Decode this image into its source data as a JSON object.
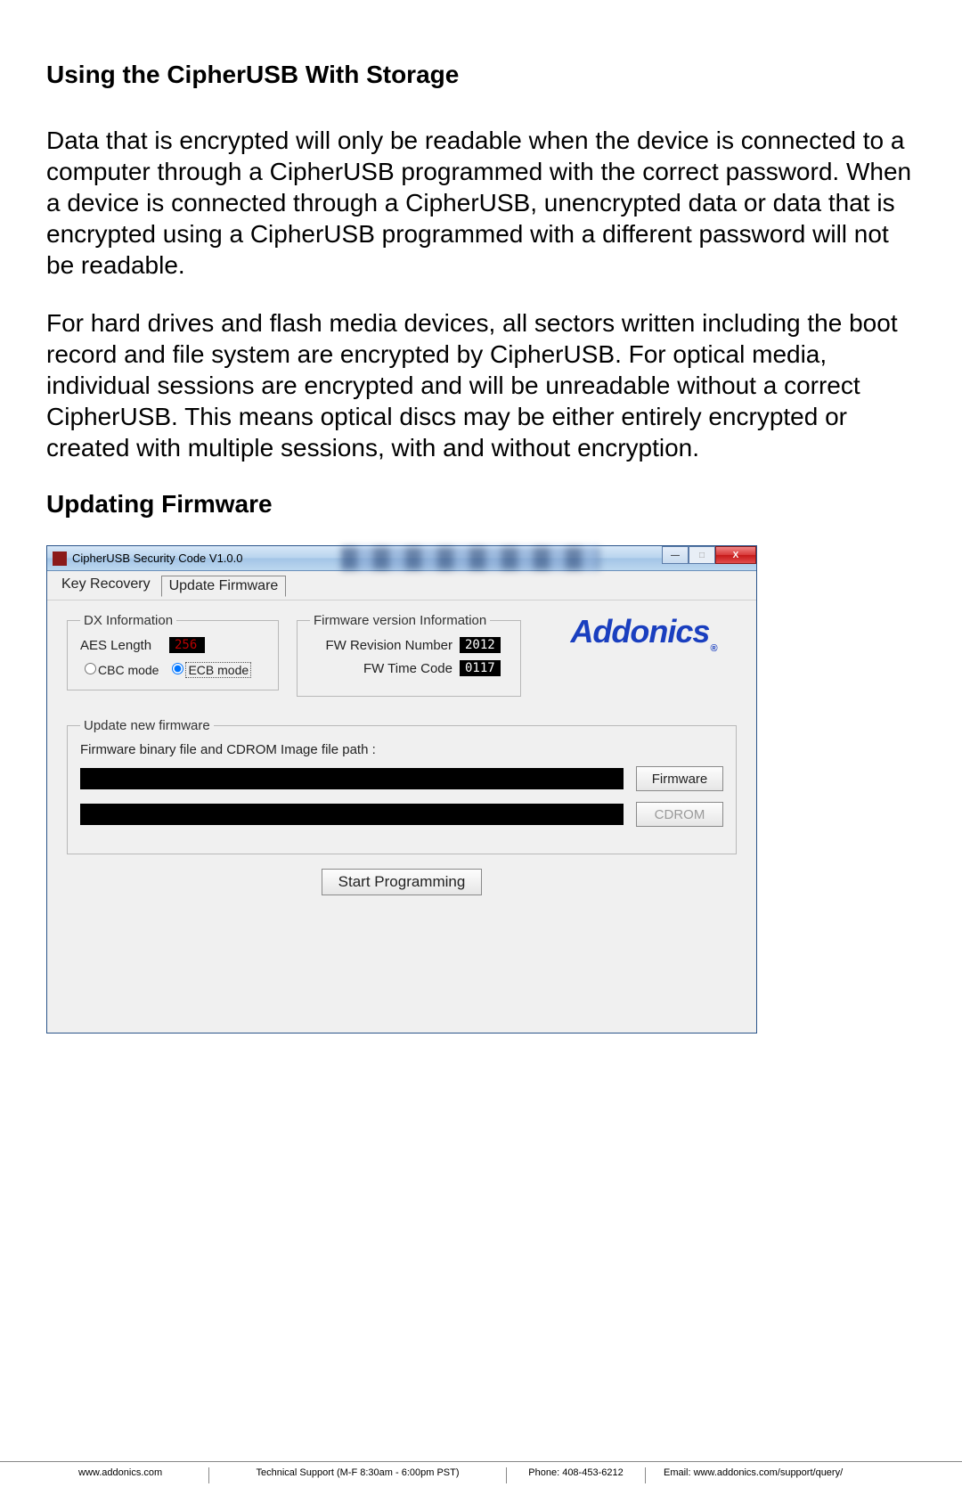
{
  "sections": {
    "title1": "Using the CipherUSB With Storage",
    "para1": "Data that is encrypted will only be readable when the device is connected to a computer through a CipherUSB programmed with the correct password. When a device is connected through a CipherUSB, unencrypted data or data that is encrypted using a CipherUSB programmed with a different password will not be readable.",
    "para2": "For hard drives and flash media devices, all sectors written including the boot record and file system are encrypted by CipherUSB. For optical media, individual sessions are encrypted and will be unreadable without a correct CipherUSB. This means optical discs may be either entirely encrypted or created with multiple sessions, with and without encryption.",
    "title2": "Updating Firmware"
  },
  "window": {
    "title": "CipherUSB Security Code V1.0.0",
    "tabs": {
      "key_recovery": "Key Recovery",
      "update_firmware": "Update Firmware"
    },
    "dx": {
      "legend": "DX Information",
      "aes_label": "AES Length",
      "aes_value": "256",
      "cbc_label": "CBC mode",
      "ecb_label": "ECB mode"
    },
    "fw": {
      "legend": "Firmware version Information",
      "rev_label": "FW Revision Number",
      "rev_value": "2012",
      "time_label": "FW Time Code",
      "time_value": "0117"
    },
    "logo": "Addonics",
    "update": {
      "legend": "Update new firmware",
      "path_label": "Firmware binary file and CDROM Image file path :",
      "firmware_btn": "Firmware",
      "cdrom_btn": "CDROM"
    },
    "start_btn": "Start Programming",
    "controls": {
      "min": "—",
      "max": "□",
      "close": "X"
    }
  },
  "footer": {
    "site": "www.addonics.com",
    "support": "Technical Support (M-F 8:30am - 6:00pm PST)",
    "phone": "Phone: 408-453-6212",
    "email": "Email: www.addonics.com/support/query/"
  }
}
